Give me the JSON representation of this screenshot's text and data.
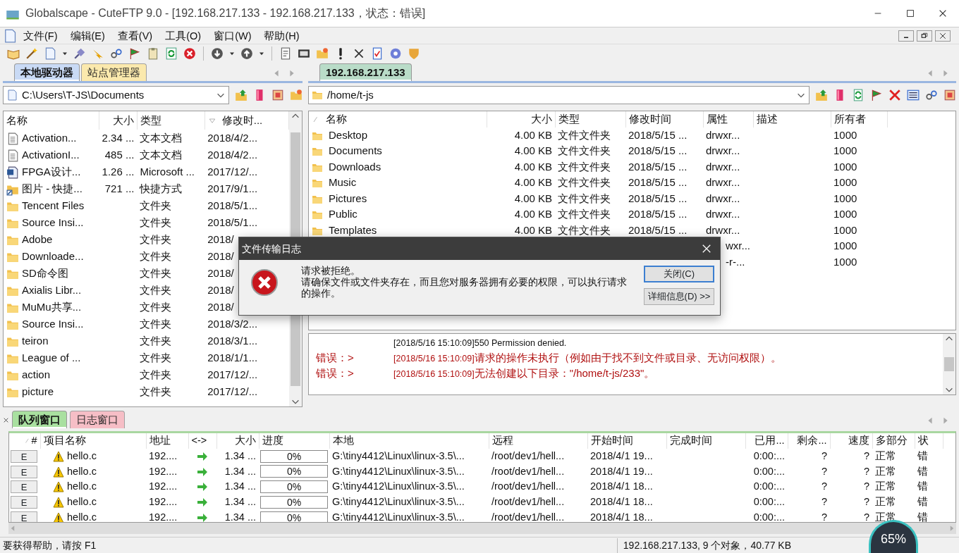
{
  "window": {
    "title": "Globalscape - CuteFTP 9.0 - [192.168.217.133 - 192.168.217.133，状态：错误]"
  },
  "menu": [
    "文件(F)",
    "编辑(E)",
    "查看(V)",
    "工具(O)",
    "窗口(W)",
    "帮助(H)"
  ],
  "left_pane": {
    "tabs": [
      {
        "label": "本地驱动器",
        "selected": true,
        "color": "#c9daf5"
      },
      {
        "label": "站点管理器",
        "selected": false,
        "color": "#fde9a6"
      }
    ],
    "path": "C:\\Users\\T-JS\\Documents",
    "columns": [
      "名称",
      "大小",
      "类型",
      "修改时..."
    ],
    "rows": [
      {
        "kind": "text",
        "name": "Activation...",
        "size": "2.34 ...",
        "type": "文本文档",
        "modified": "2018/4/2..."
      },
      {
        "kind": "text",
        "name": "ActivationI...",
        "size": "485 ...",
        "type": "文本文档",
        "modified": "2018/4/2..."
      },
      {
        "kind": "word",
        "name": "FPGA设计...",
        "size": "1.26 ...",
        "type": "Microsoft ...",
        "modified": "2017/12/..."
      },
      {
        "kind": "shortcut",
        "name": "图片 - 快捷...",
        "size": "721 ...",
        "type": "快捷方式",
        "modified": "2017/9/1..."
      },
      {
        "kind": "folder",
        "name": "Tencent Files",
        "type": "文件夹",
        "modified": "2018/5/1..."
      },
      {
        "kind": "folder",
        "name": "Source Insi...",
        "type": "文件夹",
        "modified": "2018/5/1..."
      },
      {
        "kind": "folder",
        "name": "Adobe",
        "type": "文件夹",
        "modified": "2018/"
      },
      {
        "kind": "folder",
        "name": "Downloade...",
        "type": "文件夹",
        "modified": "2018/"
      },
      {
        "kind": "folder",
        "name": "SD命令图",
        "type": "文件夹",
        "modified": "2018/"
      },
      {
        "kind": "folder",
        "name": "Axialis Libr...",
        "type": "文件夹",
        "modified": "2018/"
      },
      {
        "kind": "folder",
        "name": "MuMu共享...",
        "type": "文件夹",
        "modified": "2018/"
      },
      {
        "kind": "folder",
        "name": "Source Insi...",
        "type": "文件夹",
        "modified": "2018/3/2..."
      },
      {
        "kind": "folder",
        "name": "teiron",
        "type": "文件夹",
        "modified": "2018/3/1..."
      },
      {
        "kind": "folder",
        "name": "League of ...",
        "type": "文件夹",
        "modified": "2018/1/1..."
      },
      {
        "kind": "folder",
        "name": "action",
        "type": "文件夹",
        "modified": "2017/12/..."
      },
      {
        "kind": "folder",
        "name": "picture",
        "type": "文件夹",
        "modified": "2017/12/..."
      }
    ]
  },
  "right_pane": {
    "tabs": [
      {
        "label": "192.168.217.133",
        "selected": true,
        "color": "#b9dcc8"
      }
    ],
    "path": "/home/t-js",
    "columns": [
      "名称",
      "大小",
      "类型",
      "修改时间",
      "属性",
      "描述",
      "所有者"
    ],
    "rows": [
      {
        "kind": "folder",
        "name": "Desktop",
        "size": "4.00 KB",
        "type": "文件文件夹",
        "modified": "2018/5/15 ...",
        "attributes": "drwxr...",
        "owner": "1000"
      },
      {
        "kind": "folder",
        "name": "Documents",
        "size": "4.00 KB",
        "type": "文件文件夹",
        "modified": "2018/5/15 ...",
        "attributes": "drwxr...",
        "owner": "1000"
      },
      {
        "kind": "folder",
        "name": "Downloads",
        "size": "4.00 KB",
        "type": "文件文件夹",
        "modified": "2018/5/15 ...",
        "attributes": "drwxr...",
        "owner": "1000"
      },
      {
        "kind": "folder",
        "name": "Music",
        "size": "4.00 KB",
        "type": "文件文件夹",
        "modified": "2018/5/15 ...",
        "attributes": "drwxr...",
        "owner": "1000"
      },
      {
        "kind": "folder",
        "name": "Pictures",
        "size": "4.00 KB",
        "type": "文件文件夹",
        "modified": "2018/5/15 ...",
        "attributes": "drwxr...",
        "owner": "1000"
      },
      {
        "kind": "folder",
        "name": "Public",
        "size": "4.00 KB",
        "type": "文件文件夹",
        "modified": "2018/5/15 ...",
        "attributes": "drwxr...",
        "owner": "1000"
      },
      {
        "kind": "folder",
        "name": "Templates",
        "size": "4.00 KB",
        "type": "文件文件夹",
        "modified": "2018/5/15 ...",
        "attributes": "drwxr...",
        "owner": "1000"
      },
      {
        "kind": "covered",
        "attributes": "wxr...",
        "owner": "1000"
      },
      {
        "kind": "covered",
        "attributes": "-r-...",
        "owner": "1000"
      }
    ]
  },
  "log": [
    {
      "kind": "info",
      "time": "[2018/5/16 15:10:09]",
      "text": "550 Permission denied."
    },
    {
      "kind": "error",
      "prefix": "错误：>",
      "time": "[2018/5/16 15:10:09]",
      "text": "请求的操作未执行（例如由于找不到文件或目录、无访问权限）。"
    },
    {
      "kind": "error",
      "prefix": "错误：>",
      "time": "[2018/5/16 15:10:09]",
      "text": "无法创建以下目录：\"/home/t-js/233\"。"
    }
  ],
  "dialog": {
    "title": "文件传输日志",
    "message": [
      "请求被拒绝。",
      "请确保文件或文件夹存在，而且您对服务器拥有必要的权限，可以执行请求的操作。"
    ],
    "buttons": [
      {
        "label": "关闭(C)",
        "default": true
      },
      {
        "label": "详细信息(D) >>",
        "default": false
      }
    ]
  },
  "queue": {
    "tabs": [
      {
        "label": "队列窗口",
        "selected": true,
        "color": "#a9e0a0"
      },
      {
        "label": "日志窗口",
        "selected": false,
        "color": "#f7b9c2"
      }
    ],
    "columns": [
      "#",
      "项目名称",
      "地址",
      "<->",
      "大小",
      "进度",
      "本地",
      "远程",
      "开始时间",
      "完成时间",
      "已用...",
      "剩余...",
      "速度",
      "多部分",
      "状"
    ],
    "rows": [
      {
        "mark": "E",
        "name": "hello.c",
        "address": "192....",
        "size": "1.34 ...",
        "progress": "0%",
        "level": 0,
        "local": "G:\\tiny4412\\Linux\\linux-3.5\\...",
        "remote": "/root/dev1/hell...",
        "start": "2018/4/1 19...",
        "elapsed": "0:00:...",
        "remaining": "?",
        "speed": "?",
        "multipart": "正常",
        "status": "错"
      },
      {
        "mark": "E",
        "name": "hello.c",
        "address": "192....",
        "size": "1.34 ...",
        "progress": "0%",
        "level": 0,
        "local": "G:\\tiny4412\\Linux\\linux-3.5\\...",
        "remote": "/root/dev1/hell...",
        "start": "2018/4/1 19...",
        "elapsed": "0:00:...",
        "remaining": "?",
        "speed": "?",
        "multipart": "正常",
        "status": "错"
      },
      {
        "mark": "E",
        "name": "hello.c",
        "address": "192....",
        "size": "1.34 ...",
        "progress": "0%",
        "level": 0,
        "local": "G:\\tiny4412\\Linux\\linux-3.5\\...",
        "remote": "/root/dev1/hell...",
        "start": "2018/4/1 18...",
        "elapsed": "0:00:...",
        "remaining": "?",
        "speed": "?",
        "multipart": "正常",
        "status": "错"
      },
      {
        "mark": "E",
        "name": "hello.c",
        "address": "192....",
        "size": "1.34 ...",
        "progress": "0%",
        "level": 0,
        "local": "G:\\tiny4412\\Linux\\linux-3.5\\...",
        "remote": "/root/dev1/hell...",
        "start": "2018/4/1 18...",
        "elapsed": "0:00:...",
        "remaining": "?",
        "speed": "?",
        "multipart": "正常",
        "status": "错"
      },
      {
        "mark": "E",
        "name": "hello.c",
        "address": "192....",
        "size": "1.34 ...",
        "progress": "0%",
        "level": 0,
        "local": "G:\\tiny4412\\Linux\\linux-3.5\\...",
        "remote": "/root/dev1/hell...",
        "start": "2018/4/1 18...",
        "elapsed": "0:00:...",
        "remaining": "?",
        "speed": "?",
        "multipart": "正常",
        "status": "错"
      }
    ]
  },
  "status_bar": {
    "help": "要获得帮助，请按 F1",
    "summary": "192.168.217.133, 9 个对象，40.77 KB"
  },
  "speed_widget": {
    "percent": "65%"
  }
}
